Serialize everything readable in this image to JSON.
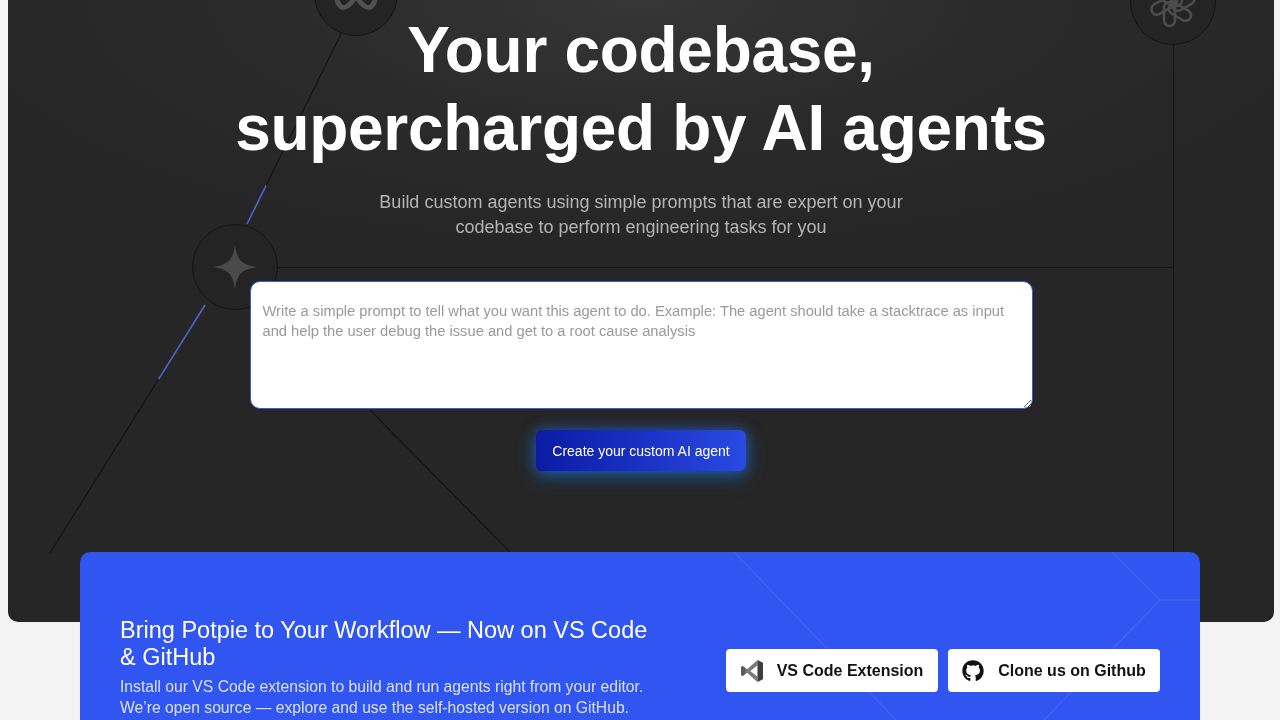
{
  "hero": {
    "heading_lines": [
      "Your codebase,",
      "supercharged by AI agents"
    ],
    "subtitle": "Build custom agents using simple prompts that are expert on your\ncodebase to perform engineering tasks for you",
    "prompt": {
      "placeholder": "Write a simple prompt to tell what you want this agent to do. Example: The agent should take a stacktrace as input and help the user debug the issue and get to a root cause analysis"
    },
    "create_button": "Create your custom AI agent"
  },
  "banner": {
    "title": "Bring Potpie to Your Workflow — Now on VS Code\n& GitHub",
    "description": "Install our VS Code extension to build and run agents right from your editor.\nWe’re open source — explore and use the self-hosted version on GitHub.",
    "buttons": [
      {
        "kind": "vscode",
        "label": "VS Code Extension"
      },
      {
        "kind": "github",
        "label": "Clone us on Github"
      }
    ]
  }
}
